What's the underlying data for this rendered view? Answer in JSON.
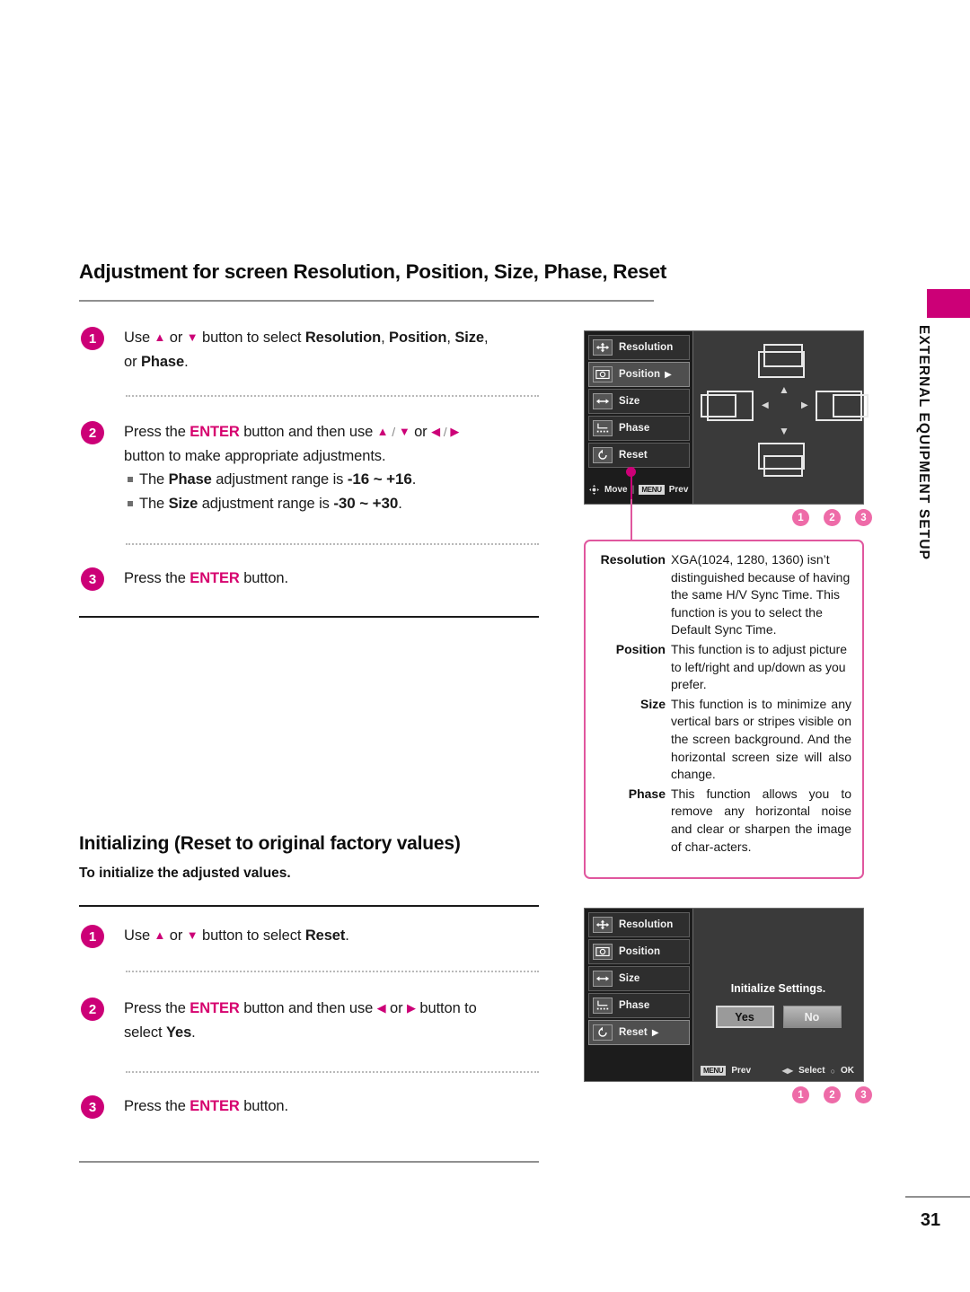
{
  "side_tab": {
    "label": "EXTERNAL EQUIPMENT SETUP",
    "color": "#CC0077"
  },
  "section1": {
    "heading": "Adjustment for screen Resolution, Position, Size, Phase, Reset",
    "steps": [
      {
        "num": "1",
        "line1_a": "Use ",
        "line1_b": " or ",
        "line1_c": " button to select ",
        "line1_bold1": "Resolution",
        "line1_sep1": ", ",
        "line1_bold2": "Position",
        "line1_sep2": ", ",
        "line1_bold3": "Size",
        "line1_sep3": ",",
        "line2_a": "or ",
        "line2_bold": "Phase",
        "line2_b": "."
      },
      {
        "num": "2",
        "line1_a": "Press the ",
        "line1_enter": "ENTER",
        "line1_b": " button and then use ",
        "line1_c": " or ",
        "line2": "button to make appropriate adjustments.",
        "bullet1_a": "The ",
        "bullet1_bold": "Phase",
        "bullet1_b": " adjustment range is ",
        "bullet1_range": "-16 ~ +16",
        "bullet1_c": ".",
        "bullet2_a": "The ",
        "bullet2_bold": "Size",
        "bullet2_b": " adjustment range is ",
        "bullet2_range": "-30 ~ +30",
        "bullet2_c": "."
      },
      {
        "num": "3",
        "line1_a": "Press the ",
        "line1_enter": "ENTER",
        "line1_b": " button."
      }
    ]
  },
  "section2": {
    "heading": "Initializing (Reset to original factory values)",
    "subheading": "To initialize the adjusted values.",
    "steps": [
      {
        "num": "1",
        "line1_a": "Use ",
        "line1_b": " or ",
        "line1_c": " button to select ",
        "line1_bold": "Reset",
        "line1_d": "."
      },
      {
        "num": "2",
        "line1_a": "Press the ",
        "line1_enter": "ENTER",
        "line1_b": " button and then use ",
        "line1_c": " or ",
        "line1_d": " button to",
        "line2_a": "select ",
        "line2_bold": "Yes",
        "line2_b": "."
      },
      {
        "num": "3",
        "line1_a": "Press the ",
        "line1_enter": "ENTER",
        "line1_b": " button."
      }
    ]
  },
  "osd1": {
    "items": [
      {
        "label": "Resolution",
        "icon": "move-cross-icon",
        "selected": false,
        "arrow": ""
      },
      {
        "label": "Position",
        "icon": "position-icon",
        "selected": true,
        "arrow": "▶"
      },
      {
        "label": "Size",
        "icon": "size-arrows-icon",
        "selected": false,
        "arrow": ""
      },
      {
        "label": "Phase",
        "icon": "phase-icon",
        "selected": false,
        "arrow": ""
      },
      {
        "label": "Reset",
        "icon": "reset-circle-icon",
        "selected": false,
        "arrow": ""
      }
    ],
    "bottom": {
      "move_label": "Move",
      "menu_chip": "MENU",
      "prev_label": "Prev"
    },
    "numbers": [
      "1",
      "2",
      "3"
    ]
  },
  "infobox": {
    "rows": [
      {
        "term": "Resolution",
        "def": "XGA(1024, 1280, 1360) isn’t distinguished because of having the same H/V Sync Time. This function is you to select the Default Sync Time."
      },
      {
        "term": "Position",
        "def": "This function is to adjust picture to left/right and up/down as you prefer."
      },
      {
        "term": "Size",
        "def": "This function is to minimize any vertical bars or stripes visible on the screen background. And the horizontal screen size will also change."
      },
      {
        "term": "Phase",
        "def": "This function allows you to remove any horizontal noise and clear or sharpen the image of char-acters."
      }
    ],
    "border_color": "#E0579E"
  },
  "osd2": {
    "items": [
      {
        "label": "Resolution",
        "icon": "move-cross-icon",
        "selected": false,
        "arrow": ""
      },
      {
        "label": "Position",
        "icon": "position-icon",
        "selected": false,
        "arrow": ""
      },
      {
        "label": "Size",
        "icon": "size-arrows-icon",
        "selected": false,
        "arrow": ""
      },
      {
        "label": "Phase",
        "icon": "phase-icon",
        "selected": false,
        "arrow": ""
      },
      {
        "label": "Reset",
        "icon": "reset-circle-icon",
        "selected": true,
        "arrow": "▶"
      }
    ],
    "dialog": {
      "title": "Initialize Settings.",
      "yes_label": "Yes",
      "no_label": "No"
    },
    "bottom": {
      "menu_chip": "MENU",
      "prev_label": "Prev",
      "select_label": "Select",
      "ok_label": "OK"
    },
    "numbers": [
      "1",
      "2",
      "3"
    ]
  },
  "footer": {
    "page_number": "31"
  }
}
